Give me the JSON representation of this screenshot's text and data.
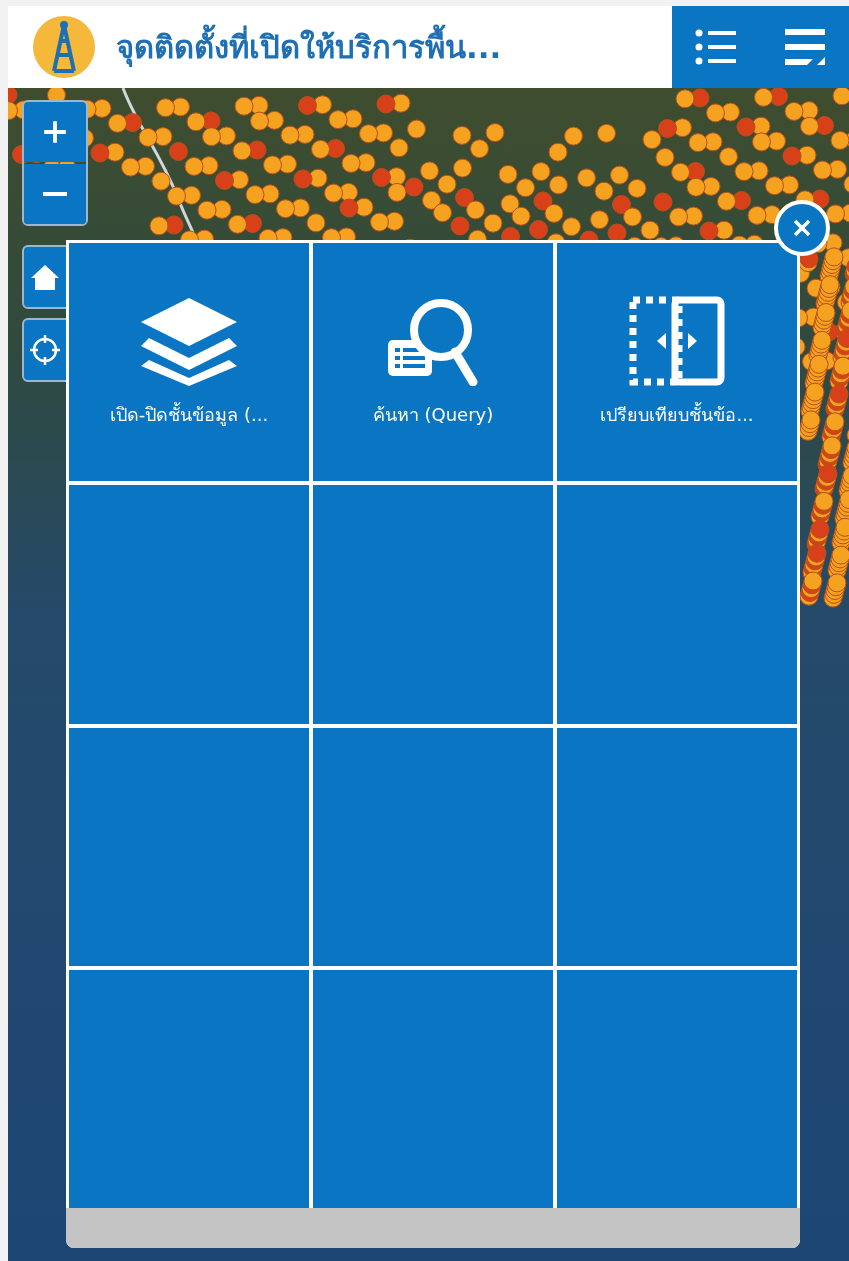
{
  "header": {
    "title": "จุดติดตั้งที่เปิดให้บริการพื้น..."
  },
  "widget_panel": {
    "tiles": [
      {
        "kind": "layers",
        "label": "เปิด-ปิดชั้นข้อมูล (..."
      },
      {
        "kind": "query",
        "label": "ค้นหา (Query)"
      },
      {
        "kind": "swipe",
        "label": "เปรียบเทียบชั้นข้อ..."
      }
    ]
  }
}
